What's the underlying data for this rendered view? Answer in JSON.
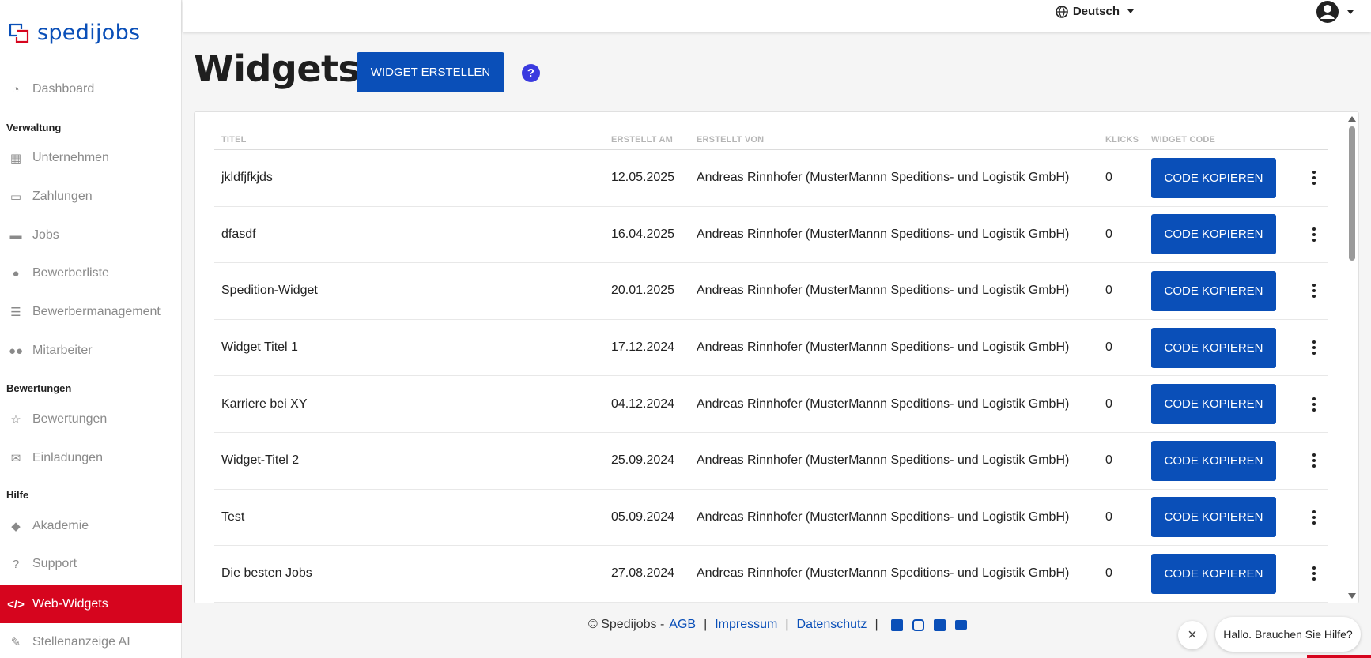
{
  "brand": {
    "name": "spedijobs",
    "primary": "#0a4fb8",
    "accent": "#d6051e"
  },
  "sidebar": {
    "dashboard": {
      "label": "Dashboard",
      "icon": "gauge-icon"
    },
    "sections": {
      "verwaltung": "Verwaltung",
      "bewertungen": "Bewertungen",
      "hilfe": "Hilfe"
    },
    "items": [
      {
        "label": "Unternehmen",
        "icon": "building-icon"
      },
      {
        "label": "Zahlungen",
        "icon": "credit-card-icon"
      },
      {
        "label": "Jobs",
        "icon": "briefcase-icon"
      },
      {
        "label": "Bewerberliste",
        "icon": "user-clock-icon"
      },
      {
        "label": "Bewerbermanagement",
        "icon": "list-icon"
      },
      {
        "label": "Mitarbeiter",
        "icon": "users-icon"
      },
      {
        "label": "Bewertungen",
        "icon": "star-icon"
      },
      {
        "label": "Einladungen",
        "icon": "envelope-icon"
      },
      {
        "label": "Akademie",
        "icon": "graduation-icon"
      },
      {
        "label": "Support",
        "icon": "question-icon"
      },
      {
        "label": "Web-Widgets",
        "icon": "code-icon",
        "active": true
      },
      {
        "label": "Stellenanzeige AI",
        "icon": "magic-wand-icon"
      }
    ]
  },
  "topbar": {
    "language": "Deutsch"
  },
  "header": {
    "title": "Widgets",
    "create_button": "WIDGET ERSTELLEN",
    "help": "?"
  },
  "table": {
    "columns": [
      "TITEL",
      "ERSTELLT AM",
      "ERSTELLT VON",
      "KLICKS",
      "WIDGET CODE"
    ],
    "copy_label": "CODE KOPIEREN",
    "rows": [
      {
        "title": "jkldfjfkjds",
        "date": "12.05.2025",
        "by": "Andreas Rinnhofer (MusterMannn Speditions- und Logistik GmbH)",
        "clicks": "0"
      },
      {
        "title": "dfasdf",
        "date": "16.04.2025",
        "by": "Andreas Rinnhofer (MusterMannn Speditions- und Logistik GmbH)",
        "clicks": "0"
      },
      {
        "title": "Spedition-Widget",
        "date": "20.01.2025",
        "by": "Andreas Rinnhofer (MusterMannn Speditions- und Logistik GmbH)",
        "clicks": "0"
      },
      {
        "title": "Widget Titel 1",
        "date": "17.12.2024",
        "by": "Andreas Rinnhofer (MusterMannn Speditions- und Logistik GmbH)",
        "clicks": "0"
      },
      {
        "title": "Karriere bei XY",
        "date": "04.12.2024",
        "by": "Andreas Rinnhofer (MusterMannn Speditions- und Logistik GmbH)",
        "clicks": "0"
      },
      {
        "title": "Widget-Titel 2",
        "date": "25.09.2024",
        "by": "Andreas Rinnhofer (MusterMannn Speditions- und Logistik GmbH)",
        "clicks": "0"
      },
      {
        "title": "Test",
        "date": "05.09.2024",
        "by": "Andreas Rinnhofer (MusterMannn Speditions- und Logistik GmbH)",
        "clicks": "0"
      },
      {
        "title": "Die besten Jobs",
        "date": "27.08.2024",
        "by": "Andreas Rinnhofer (MusterMannn Speditions- und Logistik GmbH)",
        "clicks": "0"
      }
    ]
  },
  "footer": {
    "copyright": "© Spedijobs -",
    "links": [
      "AGB",
      "Impressum",
      "Datenschutz"
    ],
    "social": [
      "facebook-icon",
      "instagram-icon",
      "linkedin-icon",
      "envelope-icon"
    ]
  },
  "chat": {
    "prompt": "Hallo. Brauchen Sie Hilfe?"
  }
}
